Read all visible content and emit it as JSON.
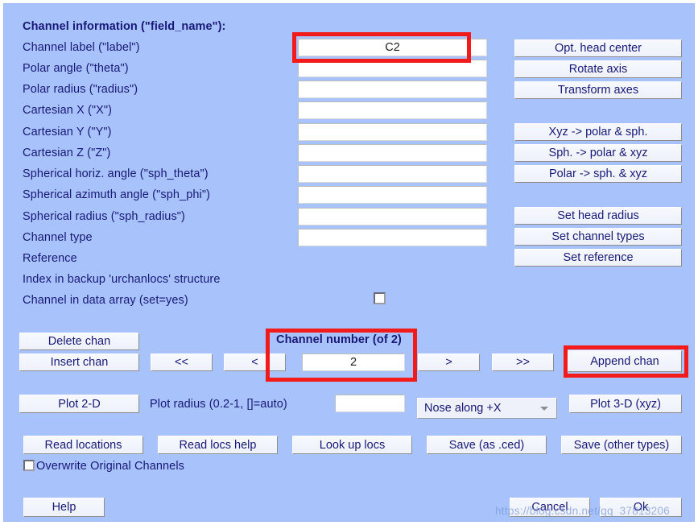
{
  "dialog": {
    "section_title": "Channel information (\"field_name\"):"
  },
  "fields": [
    {
      "label": "Channel label (\"label\")",
      "value": "C2",
      "has_input": true
    },
    {
      "label": "Polar angle (\"theta\")",
      "value": "",
      "has_input": true
    },
    {
      "label": "Polar radius (\"radius\")",
      "value": "",
      "has_input": true
    },
    {
      "label": "Cartesian X (\"X\")",
      "value": "",
      "has_input": true
    },
    {
      "label": "Cartesian Y (\"Y\")",
      "value": "",
      "has_input": true
    },
    {
      "label": "Cartesian Z (\"Z\")",
      "value": "",
      "has_input": true
    },
    {
      "label": "Spherical horiz. angle (\"sph_theta\")",
      "value": "",
      "has_input": true
    },
    {
      "label": "Spherical azimuth angle (\"sph_phi\")",
      "value": "",
      "has_input": true
    },
    {
      "label": "Spherical radius (\"sph_radius\")",
      "value": "",
      "has_input": true
    },
    {
      "label": "Channel type",
      "value": "",
      "has_input": true
    },
    {
      "label": "Reference",
      "value": "",
      "has_input": false
    },
    {
      "label": "Index in backup 'urchanlocs' structure",
      "value": "",
      "has_input": false
    },
    {
      "label": "Channel in data array (set=yes)",
      "value": "",
      "has_input": false
    }
  ],
  "right_buttons": {
    "group1": [
      "Opt. head center",
      "Rotate axis",
      "Transform axes"
    ],
    "group2": [
      "Xyz -> polar & sph.",
      "Sph. -> polar & xyz",
      "Polar -> sph. & xyz"
    ],
    "group3": [
      "Set head radius",
      "Set channel types",
      "Set reference"
    ]
  },
  "channel_nav": {
    "delete_label": "Delete chan",
    "insert_label": "Insert chan",
    "first_label": "<<",
    "prev_label": "<",
    "number_caption": "Channel number (of 2)",
    "number_value": "2",
    "next_label": ">",
    "last_label": ">>",
    "append_label": "Append chan"
  },
  "plot_row": {
    "plot2d_label": "Plot 2-D",
    "radius_label": "Plot radius (0.2-1, []=auto)",
    "radius_value": "",
    "nose_selected": "Nose along +X",
    "plot3d_label": "Plot 3-D (xyz)"
  },
  "io_row": {
    "read_locations": "Read locations",
    "read_locs_help": "Read locs help",
    "look_up_locs": "Look up locs",
    "save_ced": "Save (as .ced)",
    "save_other": "Save (other types)",
    "overwrite_label": "Overwrite Original Channels"
  },
  "footer": {
    "help_label": "Help",
    "cancel_label": "Cancel",
    "ok_label": "Ok"
  },
  "watermark": {
    "text": "https://blog.csdn.net/qq_37813206"
  },
  "colors": {
    "dialog_background": "#a8c2fb",
    "text": "#181878",
    "highlight_box": "#f31a1a",
    "button_face": "#eef1fa"
  }
}
